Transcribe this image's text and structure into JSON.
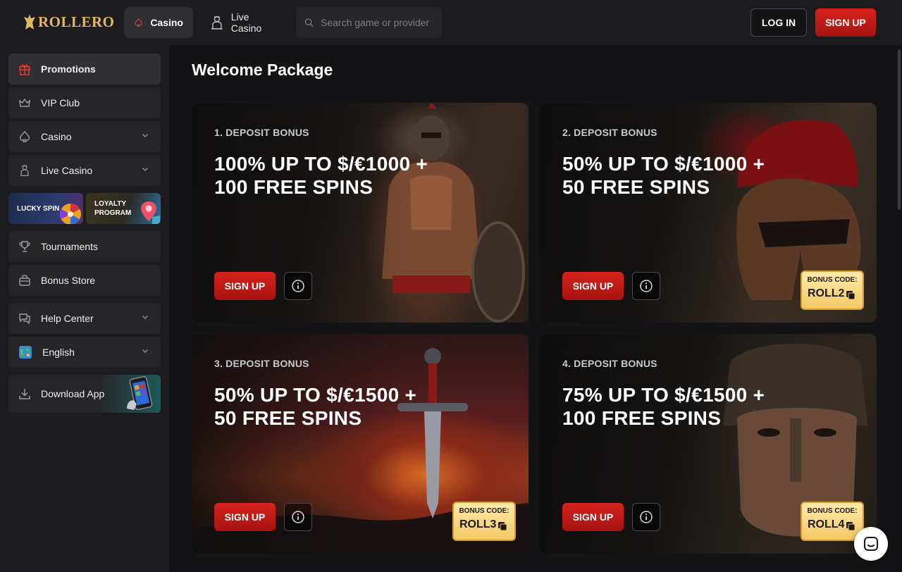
{
  "header": {
    "logo_text": "ROLLERO",
    "nav": {
      "casino": "Casino",
      "live_casino": "Live Casino"
    },
    "search_placeholder": "Search game or provider",
    "login": "LOG IN",
    "signup": "SIGN UP"
  },
  "sidebar": {
    "promotions": "Promotions",
    "vip_club": "VIP Club",
    "casino": "Casino",
    "live_casino": "Live Casino",
    "lucky_spin": "LUCKY SPIN",
    "loyalty_line1": "LOYALTY",
    "loyalty_line2": "PROGRAM",
    "tournaments": "Tournaments",
    "bonus_store": "Bonus Store",
    "help_center": "Help Center",
    "language": "English",
    "download_app": "Download App"
  },
  "main": {
    "title": "Welcome Package",
    "cards": [
      {
        "label": "1. DEPOSIT BONUS",
        "line1": "100% UP TO $/€1000 +",
        "line2": "100 FREE SPINS",
        "button": "SIGN UP"
      },
      {
        "label": "2. DEPOSIT BONUS",
        "line1": "50% UP TO $/€1000 +",
        "line2": "50 FREE SPINS",
        "button": "SIGN UP",
        "code_title": "BONUS CODE:",
        "code": "ROLL2"
      },
      {
        "label": "3. DEPOSIT BONUS",
        "line1": "50% UP TO $/€1500 +",
        "line2": "50 FREE SPINS",
        "button": "SIGN UP",
        "code_title": "BONUS CODE:",
        "code": "ROLL3"
      },
      {
        "label": "4. DEPOSIT BONUS",
        "line1": "75% UP TO $/€1500 +",
        "line2": "100 FREE SPINS",
        "button": "SIGN UP",
        "code_title": "BONUS CODE:",
        "code": "ROLL4"
      }
    ]
  },
  "colors": {
    "accent_red": "#d8231f",
    "gold": "#e2b862",
    "background": "#141416",
    "panel": "#1c1c1f"
  },
  "icons": [
    "crown-logo-icon",
    "spade-icon",
    "dealer-icon",
    "search-icon",
    "gift-icon",
    "crown-icon",
    "chevron-down-icon",
    "trophy-icon",
    "bag-icon",
    "chat-bubbles-icon",
    "globe-icon",
    "download-icon",
    "info-icon",
    "copy-icon",
    "chat-icon"
  ]
}
